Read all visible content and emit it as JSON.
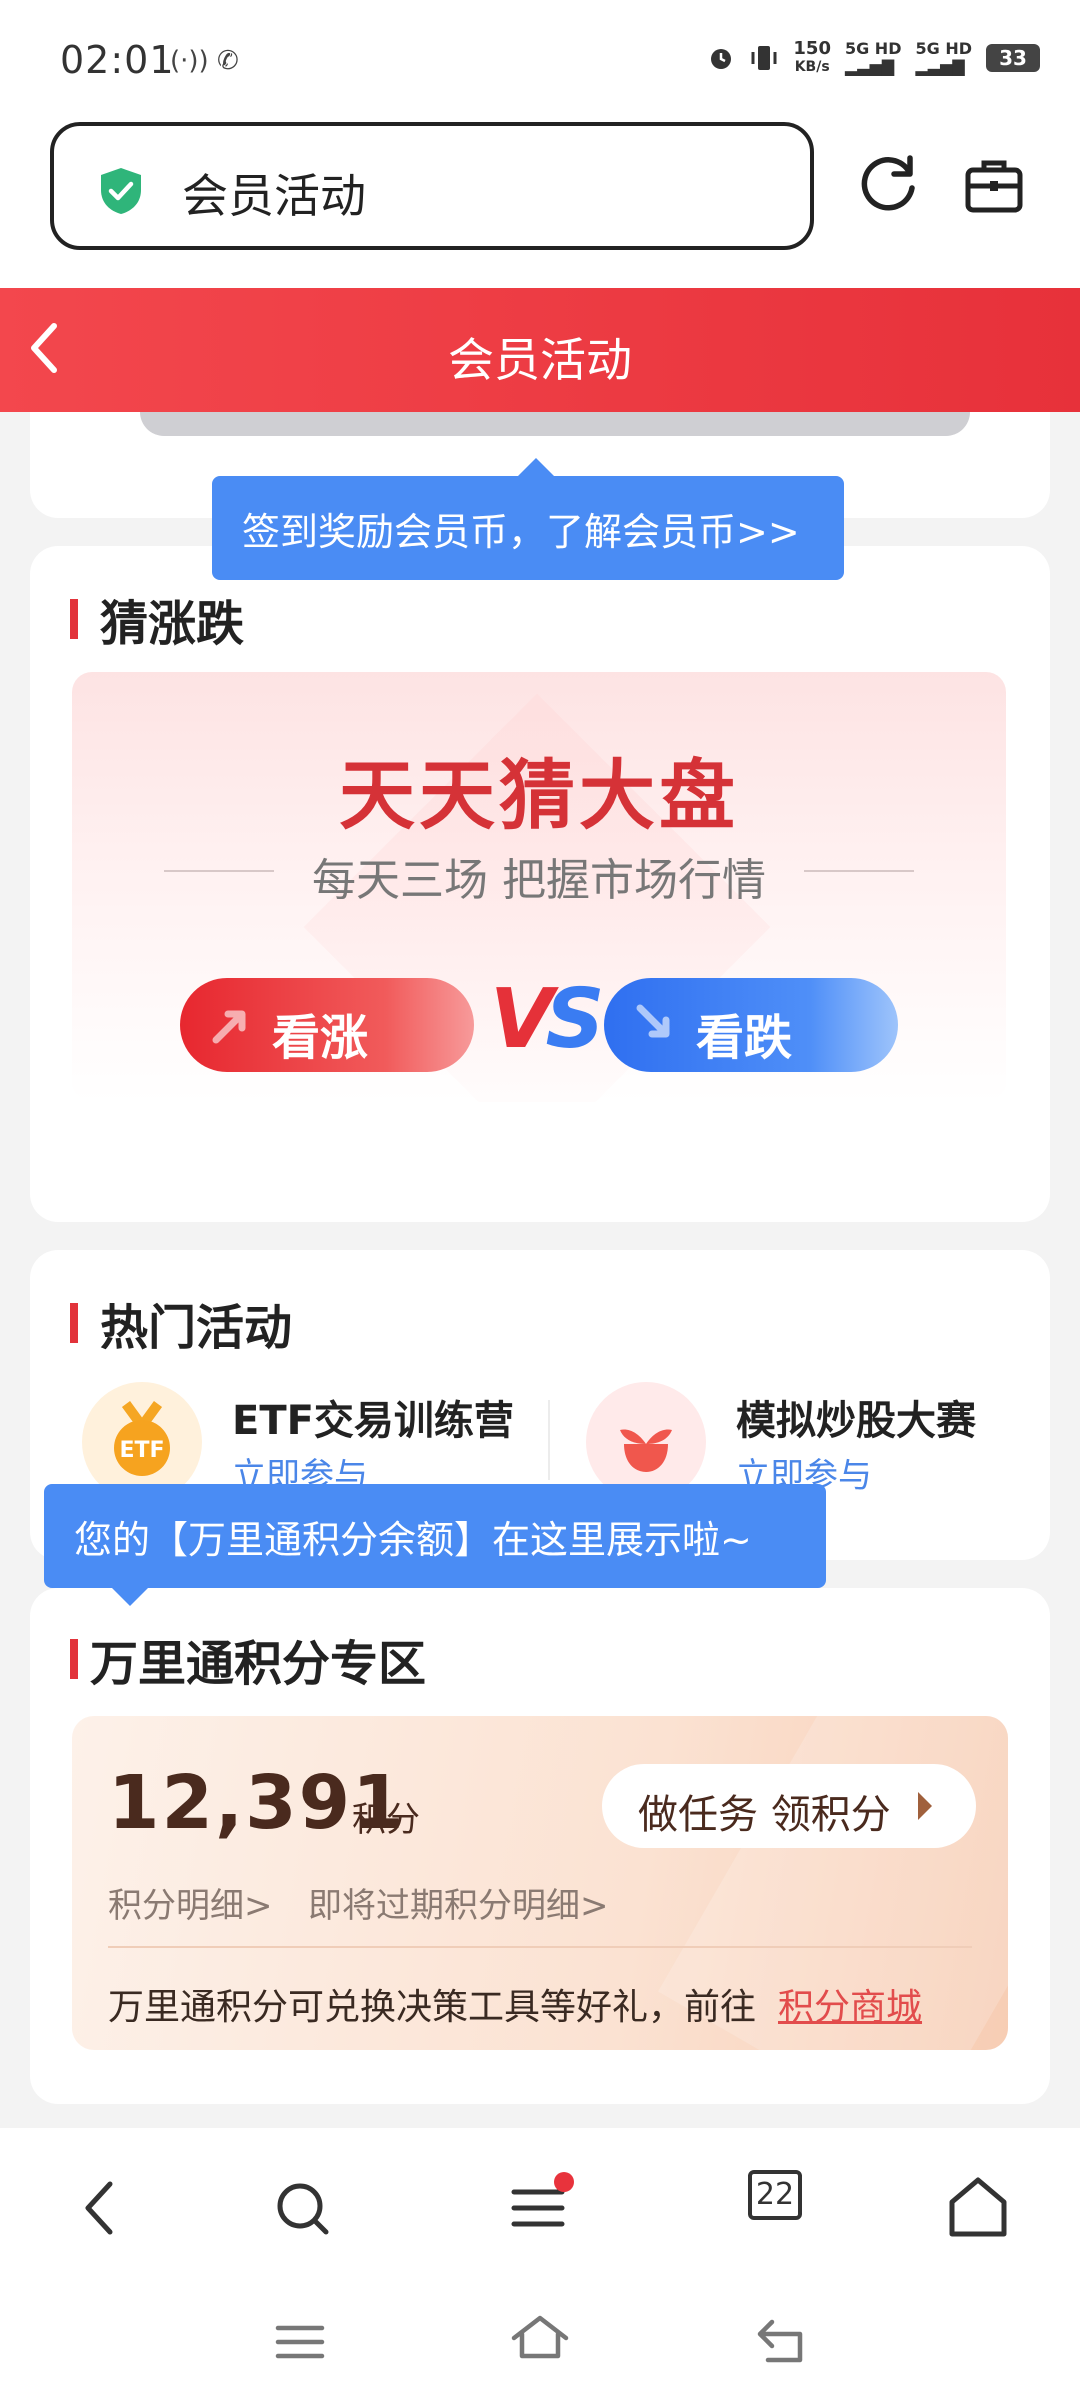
{
  "status_bar": {
    "time": "02:01",
    "left_icons": "(·)) ✆",
    "network_speed_value": "150",
    "network_speed_unit": "KB/s",
    "signal1": "5G HD",
    "signal2": "5G HD",
    "battery": "33"
  },
  "browser": {
    "url_text": "会员活动"
  },
  "header": {
    "title": "会员活动"
  },
  "tooltips": {
    "checkin": "签到奖励会员币，了解会员币>>",
    "points": "您的【万里通积分余额】在这里展示啦~"
  },
  "guess": {
    "section_title": "猜涨跌",
    "banner_title": "天天猜大盘",
    "banner_subtitle": "每天三场 把握市场行情",
    "up_label": "看涨",
    "down_label": "看跌",
    "vs_v": "V",
    "vs_s": "S"
  },
  "hot": {
    "section_title": "热门活动",
    "items": [
      {
        "name": "ETF交易训练营",
        "action": "立即参与",
        "icon_text": "ETF"
      },
      {
        "name": "模拟炒股大赛",
        "action": "立即参与"
      }
    ]
  },
  "points": {
    "section_title": "万里通积分专区",
    "amount": "12,391",
    "unit": "积分",
    "task_button": "做任务 领积分",
    "detail_link": "积分明细>",
    "expiring_link": "即将过期积分明细>",
    "note": "万里通积分可兑换决策工具等好礼，前往",
    "mall_link": "积分商城"
  },
  "browser_nav": {
    "tabs_count": "22"
  },
  "colors": {
    "header_red": "#e7313a",
    "tooltip_blue": "#4a8cf4",
    "link_blue": "#4a86e8",
    "shield_green": "#2fb57a"
  }
}
